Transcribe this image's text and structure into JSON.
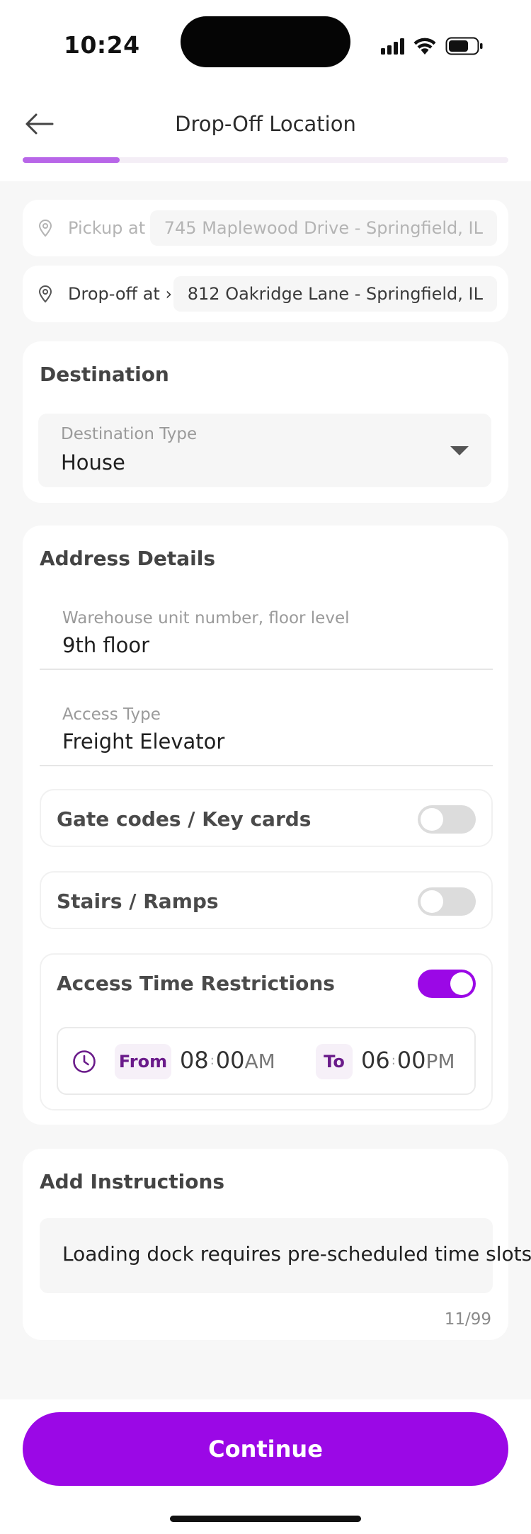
{
  "status_bar": {
    "time": "10:24"
  },
  "header": {
    "title": "Drop-Off Location",
    "back_icon": "arrow-left-icon",
    "progress": 0.2
  },
  "pickup": {
    "label": "Pickup at ›",
    "address": "745 Maplewood Drive - Springfield, IL"
  },
  "dropoff": {
    "label": "Drop-off at ›",
    "address": "812 Oakridge Lane - Springfield, IL"
  },
  "destination": {
    "title": "Destination",
    "type_label": "Destination Type",
    "type_value": "House"
  },
  "address_details": {
    "title": "Address Details",
    "unit_label": "Warehouse unit number, floor level",
    "unit_value": "9th floor",
    "access_label": "Access Type",
    "access_value": "Freight Elevator",
    "toggles": [
      {
        "label": "Gate codes / Key cards",
        "on": false
      },
      {
        "label": "Stairs / Ramps",
        "on": false
      },
      {
        "label": "Access Time Restrictions",
        "on": true
      }
    ],
    "time": {
      "from_label": "From",
      "from_hour": "08",
      "from_min": "00",
      "from_ampm": "AM",
      "to_label": "To",
      "to_hour": "06",
      "to_min": "00",
      "to_ampm": "PM"
    }
  },
  "instructions": {
    "title": "Add Instructions",
    "text": "Loading dock requires pre-scheduled time slots",
    "counter": "11/99"
  },
  "footer": {
    "continue_label": "Continue"
  },
  "colors": {
    "accent": "#9B08E6",
    "progress": "#B866E8",
    "chip_text": "#6A1B8A"
  }
}
